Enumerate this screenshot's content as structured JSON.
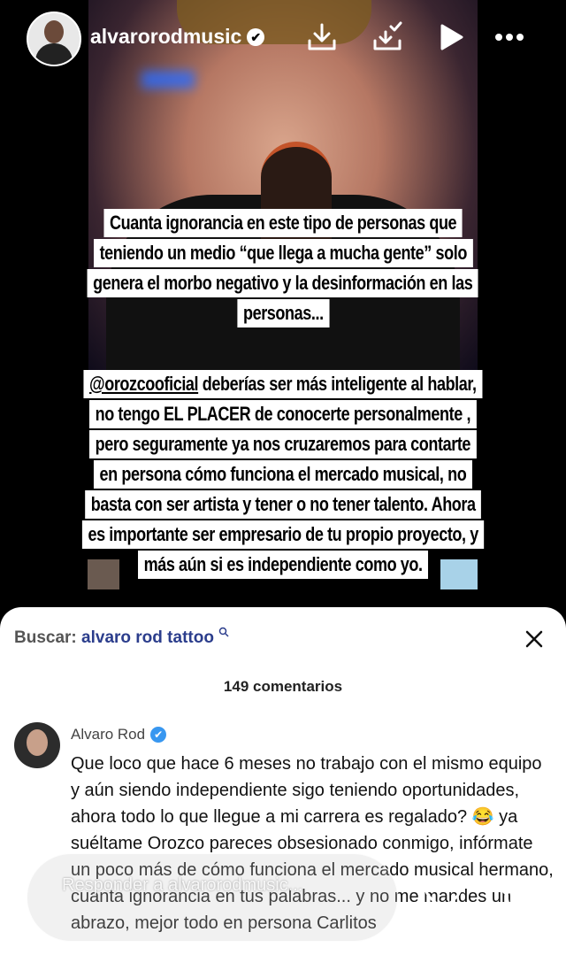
{
  "header": {
    "username": "alvarorodmusic",
    "verified_mark": "✔",
    "icons": [
      "download-icon",
      "download-check-icon",
      "play-icon",
      "more-icon"
    ]
  },
  "story_text": {
    "paragraph1": [
      "Cuanta ignorancia en este tipo de personas que",
      "teniendo un medio “que llega a mucha gente” solo",
      "genera el morbo negativo y la desinformación en las",
      "personas..."
    ],
    "paragraph2_mention": "@orozcooficial",
    "paragraph2_first_rest": " deberías ser más inteligente al hablar,",
    "paragraph2": [
      "no tengo EL PLACER de conocerte  personalmente ,",
      "pero seguramente ya nos cruzaremos para contarte",
      "en persona cómo funciona el mercado musical, no",
      "basta con ser artista y tener o no tener talento. Ahora",
      "es importante ser empresario de tu propio proyecto, y",
      "más aún si es independiente como yo."
    ]
  },
  "comments_sheet": {
    "search_label": "Buscar:",
    "search_query": "alvaro rod tattoo",
    "count": "149 comentarios",
    "comment": {
      "author": "Alvaro Rod",
      "text": "Que loco que hace 6 meses no trabajo con el mismo equipo y aún siendo independiente sigo teniendo oportunidades, ahora todo lo que llegue a mi carrera es regalado? 😂 ya suéltame Orozco pareces obsesionado conmigo, infórmate un poco más de cómo funciona el mercado musical hermano, cuanta ignorancia en tus palabras... y no me mandes un abrazo, mejor todo en persona Carlitos"
    }
  },
  "reply_bar": {
    "placeholder": "Responder a alvarorodmusic..."
  }
}
